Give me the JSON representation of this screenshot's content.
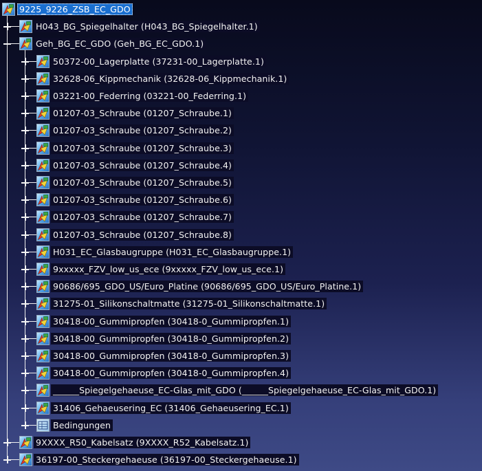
{
  "tree": {
    "root": {
      "label": "9225_9226_ZSB_EC_GDO",
      "selected": true,
      "icon": "product-icon"
    },
    "items": [
      {
        "label": "H043_BG_Spiegelhalter (H043_BG_Spiegelhalter.1)",
        "depth": 1,
        "expander": "plus",
        "icon": "product-icon"
      },
      {
        "label": "Geh_BG_EC_GDO (Geh_BG_EC_GDO.1)",
        "depth": 1,
        "expander": "minus",
        "icon": "product-icon"
      },
      {
        "label": "50372-00_Lagerplatte (37231-00_Lagerplatte.1)",
        "depth": 2,
        "expander": "plus",
        "icon": "product-icon"
      },
      {
        "label": "32628-06_Kippmechanik (32628-06_Kippmechanik.1)",
        "depth": 2,
        "expander": "plus",
        "icon": "product-icon"
      },
      {
        "label": "03221-00_Federring (03221-00_Federring.1)",
        "depth": 2,
        "expander": "plus",
        "icon": "product-icon"
      },
      {
        "label": "01207-03_Schraube (01207_Schraube.1)",
        "depth": 2,
        "expander": "plus",
        "icon": "product-icon"
      },
      {
        "label": "01207-03_Schraube (01207_Schraube.2)",
        "depth": 2,
        "expander": "plus",
        "icon": "product-icon"
      },
      {
        "label": "01207-03_Schraube (01207_Schraube.3)",
        "depth": 2,
        "expander": "plus",
        "icon": "product-icon"
      },
      {
        "label": "01207-03_Schraube (01207_Schraube.4)",
        "depth": 2,
        "expander": "plus",
        "icon": "product-icon"
      },
      {
        "label": "01207-03_Schraube (01207_Schraube.5)",
        "depth": 2,
        "expander": "plus",
        "icon": "product-icon"
      },
      {
        "label": "01207-03_Schraube (01207_Schraube.6)",
        "depth": 2,
        "expander": "plus",
        "icon": "product-icon"
      },
      {
        "label": "01207-03_Schraube (01207_Schraube.7)",
        "depth": 2,
        "expander": "plus",
        "icon": "product-icon"
      },
      {
        "label": "01207-03_Schraube (01207_Schraube.8)",
        "depth": 2,
        "expander": "plus",
        "icon": "product-icon"
      },
      {
        "label": "H031_EC_Glasbaugruppe (H031_EC_Glasbaugruppe.1)",
        "depth": 2,
        "expander": "plus",
        "icon": "product-icon"
      },
      {
        "label": "9xxxxx_FZV_low_us_ece (9xxxxx_FZV_low_us_ece.1)",
        "depth": 2,
        "expander": "plus",
        "icon": "product-icon"
      },
      {
        "label": "90686/695_GDO_US/Euro_Platine (90686/695_GDO_US/Euro_Platine.1)",
        "depth": 2,
        "expander": "plus",
        "icon": "product-icon"
      },
      {
        "label": "31275-01_Silikonschaltmatte (31275-01_Silikonschaltmatte.1)",
        "depth": 2,
        "expander": "plus",
        "icon": "product-icon"
      },
      {
        "label": "30418-00_Gummipropfen (30418-0_Gummipropfen.1)",
        "depth": 2,
        "expander": "plus",
        "icon": "product-icon"
      },
      {
        "label": "30418-00_Gummipropfen (30418-0_Gummipropfen.2)",
        "depth": 2,
        "expander": "plus",
        "icon": "product-icon"
      },
      {
        "label": "30418-00_Gummipropfen (30418-0_Gummipropfen.3)",
        "depth": 2,
        "expander": "plus",
        "icon": "product-icon"
      },
      {
        "label": "30418-00_Gummipropfen (30418-0_Gummipropfen.4)",
        "depth": 2,
        "expander": "plus",
        "icon": "product-icon"
      },
      {
        "label": "______Spiegelgehaeuse_EC-Glas_mit_GDO (______Spiegelgehaeuse_EC-Glas_mit_GDO.1)",
        "depth": 2,
        "expander": "plus",
        "icon": "product-icon"
      },
      {
        "label": "31406_Gehaeusering_EC (31406_Gehaeusering_EC.1)",
        "depth": 2,
        "expander": "plus",
        "icon": "product-icon"
      },
      {
        "label": "Bedingungen",
        "depth": 2,
        "expander": "plus",
        "icon": "constraints-icon"
      },
      {
        "label": "9XXXX_R50_Kabelsatz (9XXXX_R52_Kabelsatz.1)",
        "depth": 1,
        "expander": "plus",
        "icon": "product-icon"
      },
      {
        "label": "36197-00_Steckergehaeuse (36197-00_Steckergehaeuse.1)",
        "depth": 1,
        "expander": "plus",
        "icon": "product-icon"
      }
    ]
  },
  "colors": {
    "label_bg": "#0c0c26",
    "label_text": "#f2f2f2",
    "selected_bg": "#1a6fd0",
    "tree_line": "#f0f0f0"
  }
}
